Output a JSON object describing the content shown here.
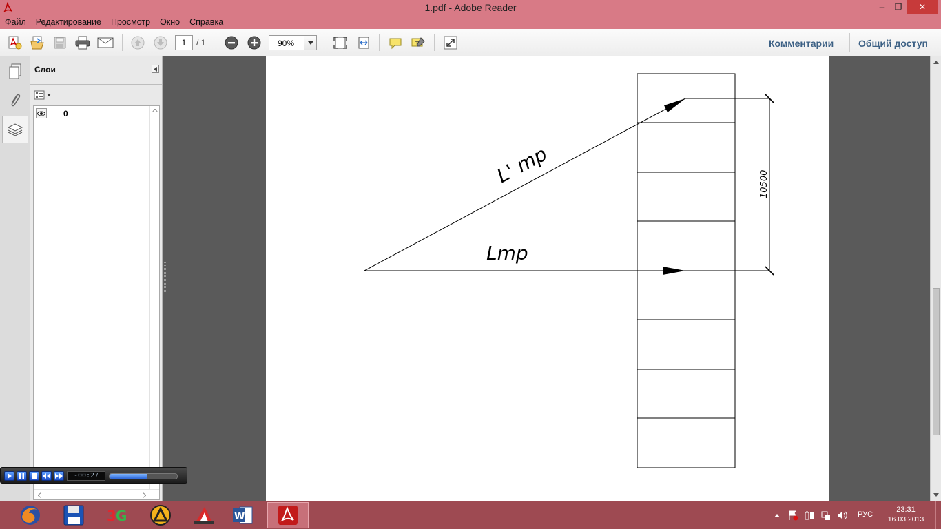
{
  "window": {
    "title": "1.pdf - Adobe Reader",
    "minimize_glyph": "–",
    "maximize_glyph": "❐",
    "close_glyph": "✕"
  },
  "menu": [
    "Файл",
    "Редактирование",
    "Просмотр",
    "Окно",
    "Справка"
  ],
  "toolbar": {
    "page_current": "1",
    "page_total": "/ 1",
    "zoom": "90%",
    "comments_label": "Комментарии",
    "share_label": "Общий доступ",
    "icons": [
      "create-pdf-icon",
      "open-icon",
      "save-icon",
      "print-icon",
      "email-icon",
      "previous-page-icon",
      "next-page-icon",
      "zoom-out-icon",
      "zoom-in-icon",
      "fit-page-icon",
      "fit-width-icon",
      "comment-icon",
      "highlight-icon",
      "full-screen-icon"
    ]
  },
  "panel": {
    "title": "Слои",
    "layers": [
      {
        "name": "0",
        "visible": true
      }
    ]
  },
  "drawing": {
    "label_incline": "L' mp",
    "label_horizontal": "Lmp",
    "dimension": "10500"
  },
  "player": {
    "time": "-00:27",
    "progress": 0.55
  },
  "taskbar": {
    "apps": [
      "firefox-icon",
      "save-floppy-icon",
      "3d-app-icon",
      "archicad-icon",
      "autocad-icon",
      "word-icon",
      "adobe-reader-icon"
    ],
    "active_app": "adobe-reader-icon",
    "language": "РУС",
    "time": "23:31",
    "date": "16.03.2013"
  },
  "colors": {
    "titlebar": "#d87a86",
    "taskbar": "#9e4a52",
    "link": "#3d6185",
    "document_bg": "#5a5a5a"
  }
}
